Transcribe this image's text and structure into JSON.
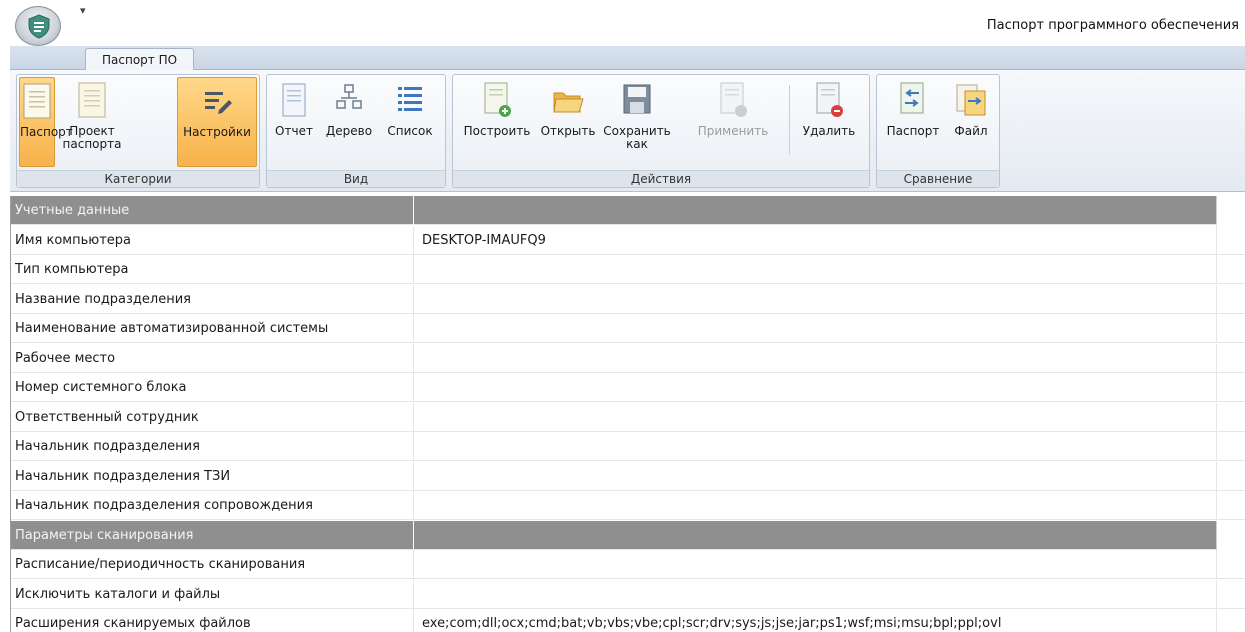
{
  "window": {
    "title": "Паспорт программного обеспечения",
    "qat_symbol": "▾"
  },
  "tabs": [
    {
      "label": "Паспорт ПО",
      "active": true
    }
  ],
  "ribbon": {
    "groups": [
      {
        "label": "Категории",
        "buttons": [
          {
            "label": "Паспорт",
            "icon": "document-icon",
            "active": true
          },
          {
            "label": "Проект паспорта",
            "icon": "document-draft-icon",
            "active": false
          },
          {
            "label": "Настройки",
            "icon": "settings-edit-icon",
            "active": true
          }
        ]
      },
      {
        "label": "Вид",
        "buttons": [
          {
            "label": "Отчет",
            "icon": "report-icon"
          },
          {
            "label": "Дерево",
            "icon": "tree-icon"
          },
          {
            "label": "Список",
            "icon": "list-icon"
          }
        ]
      },
      {
        "label": "Действия",
        "buttons": [
          {
            "label": "Построить",
            "icon": "build-document-icon"
          },
          {
            "label": "Открыть",
            "icon": "open-folder-icon"
          },
          {
            "label": "Сохранить как",
            "icon": "save-icon"
          },
          {
            "label": "Применить",
            "icon": "apply-icon",
            "disabled": true
          },
          {
            "label": "Удалить",
            "icon": "delete-icon"
          }
        ]
      },
      {
        "label": "Сравнение",
        "buttons": [
          {
            "label": "Паспорт",
            "icon": "compare-passport-icon"
          },
          {
            "label": "Файл",
            "icon": "compare-file-icon"
          }
        ]
      }
    ]
  },
  "grid": {
    "rows": [
      {
        "type": "section",
        "label": "Учетные данные",
        "value": ""
      },
      {
        "type": "field",
        "label": "Имя компьютера",
        "value": "DESKTOP-IMAUFQ9"
      },
      {
        "type": "field",
        "label": "Тип компьютера",
        "value": ""
      },
      {
        "type": "field",
        "label": "Название подразделения",
        "value": ""
      },
      {
        "type": "field",
        "label": "Наименование автоматизированной системы",
        "value": ""
      },
      {
        "type": "field",
        "label": "Рабочее место",
        "value": ""
      },
      {
        "type": "field",
        "label": "Номер системного блока",
        "value": ""
      },
      {
        "type": "field",
        "label": "Ответственный сотрудник",
        "value": ""
      },
      {
        "type": "field",
        "label": "Начальник подразделения",
        "value": ""
      },
      {
        "type": "field",
        "label": "Начальник подразделения ТЗИ",
        "value": ""
      },
      {
        "type": "field",
        "label": "Начальник подразделения сопровождения",
        "value": ""
      },
      {
        "type": "section",
        "label": "Параметры сканирования",
        "value": ""
      },
      {
        "type": "field",
        "label": "Расписание/периодичность сканирования",
        "value": ""
      },
      {
        "type": "field",
        "label": "Исключить каталоги и файлы",
        "value": ""
      },
      {
        "type": "field",
        "label": "Расширения сканируемых файлов",
        "value": "exe;com;dll;ocx;cmd;bat;vb;vbs;vbe;cpl;scr;drv;sys;js;jse;jar;ps1;wsf;msi;msu;bpl;ppl;ovl"
      }
    ]
  },
  "colors": {
    "active_button": "#f7b24a",
    "section_row": "#8f8f8f"
  }
}
